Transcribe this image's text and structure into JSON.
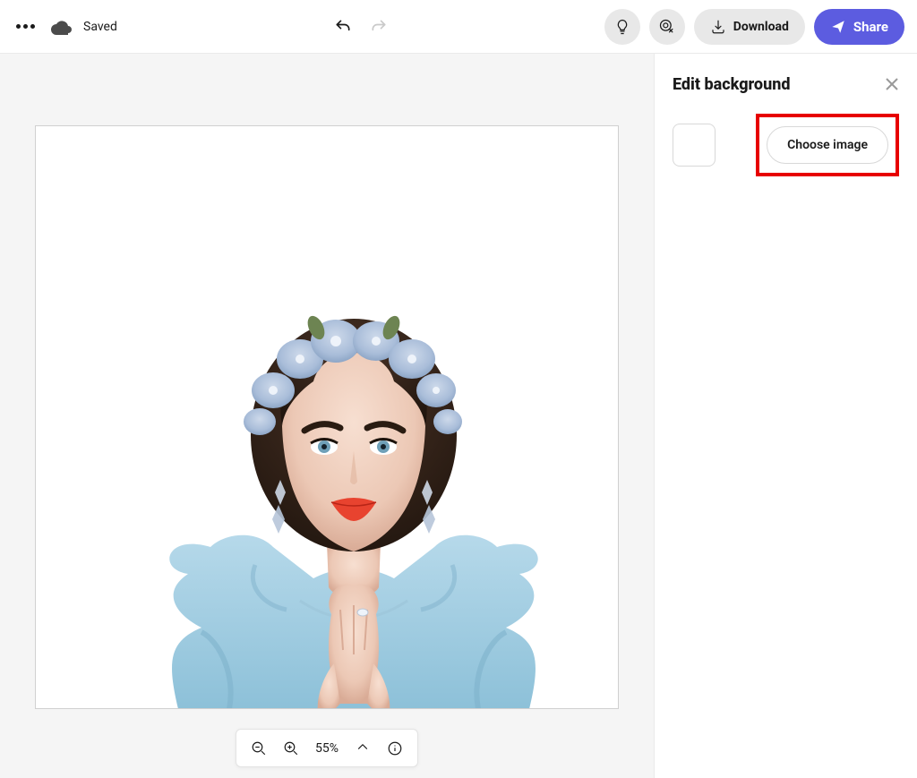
{
  "topbar": {
    "saved_label": "Saved",
    "download_label": "Download",
    "share_label": "Share"
  },
  "zoom": {
    "value": "55%"
  },
  "panel": {
    "title": "Edit background",
    "choose_image_label": "Choose image"
  },
  "colors": {
    "accent": "#5c5ce0",
    "highlight_box": "#e70000",
    "canvas_bg": "#f5f5f5"
  }
}
